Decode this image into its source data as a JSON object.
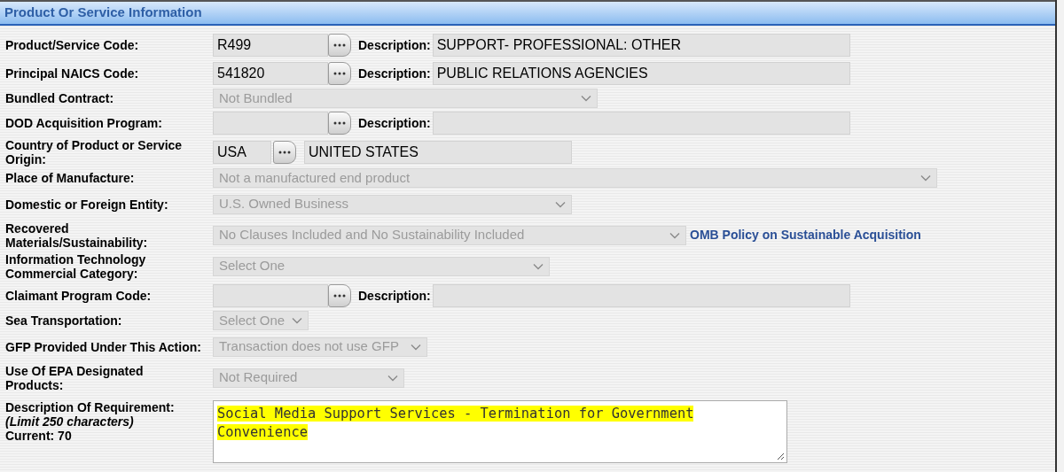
{
  "section": {
    "title": "Product Or Service Information"
  },
  "rows": [
    {
      "kind": "lookup",
      "label": "Product/Service Code:",
      "code": "R499",
      "description_label": "Description:",
      "description": "SUPPORT- PROFESSIONAL: OTHER"
    },
    {
      "kind": "lookup",
      "label": "Principal NAICS Code:",
      "code": "541820",
      "description_label": "Description:",
      "description": "PUBLIC RELATIONS AGENCIES"
    },
    {
      "kind": "select",
      "label": "Bundled Contract:",
      "value": "Not Bundled",
      "disabled": true
    },
    {
      "kind": "lookup",
      "label": "DOD Acquisition Program:",
      "description_label": "Description:"
    },
    {
      "kind": "inline_lookup",
      "label": "Country of Product or Service Origin:",
      "code": "USA",
      "description": "UNITED STATES"
    },
    {
      "kind": "select",
      "label": "Place of Manufacture:",
      "value": "Not a manufactured end product",
      "disabled": true
    },
    {
      "kind": "select",
      "label": "Domestic or Foreign Entity:",
      "value": "U.S. Owned Business",
      "disabled": true
    },
    {
      "kind": "select",
      "label": "Recovered Materials/Sustainability:",
      "value": "No Clauses Included and No Sustainability Included",
      "disabled": true,
      "link": "OMB Policy on Sustainable Acquisition"
    },
    {
      "kind": "select",
      "label": "Information Technology Commercial Category:",
      "value": "Select One",
      "disabled": true
    },
    {
      "kind": "lookup",
      "label": "Claimant Program Code:",
      "description_label": "Description:"
    },
    {
      "kind": "select",
      "label": "Sea Transportation:",
      "value": "Select One",
      "disabled": true
    },
    {
      "kind": "select",
      "label": "GFP Provided Under This Action:",
      "value": "Transaction does not use GFP",
      "disabled": true
    },
    {
      "kind": "select",
      "label": "Use Of EPA Designated Products:",
      "value": "Not Required",
      "disabled": true
    },
    {
      "kind": "textarea",
      "label": "Description Of Requirement:",
      "note": "(Limit 250 characters)",
      "counter": "Current: 70",
      "value": "Social Media Support Services - Termination for Government Convenience",
      "highlighted": true
    }
  ]
}
